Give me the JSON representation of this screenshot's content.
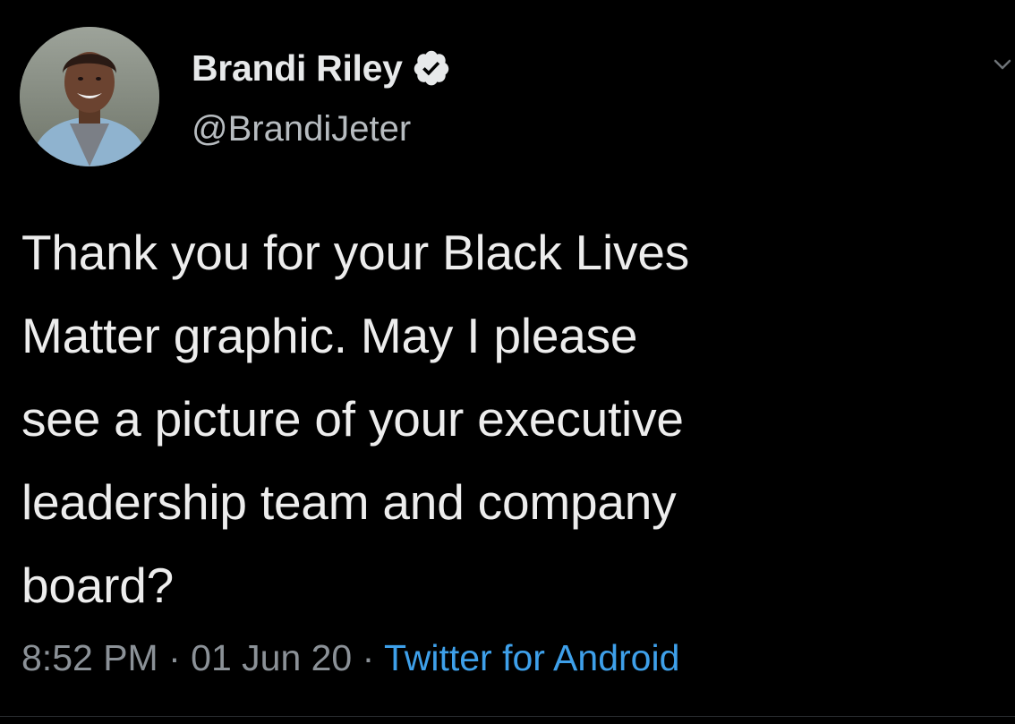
{
  "tweet": {
    "author": {
      "display_name": "Brandi Riley",
      "handle": "@BrandiJeter",
      "verified_icon": "verified-badge-icon"
    },
    "text": "Thank you for your Black Lives\nMatter graphic. May I please\nsee a picture of your executive\nleadership team and company\nboard?",
    "time": "8:52 PM",
    "separator": " · ",
    "date": "01 Jun 20",
    "source": "Twitter for Android"
  },
  "colors": {
    "background": "#000000",
    "text": "#e7e9ea",
    "secondary_text": "#8b9197",
    "link": "#3ea0ea"
  }
}
